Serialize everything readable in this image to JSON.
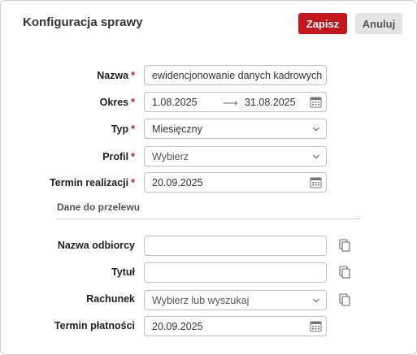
{
  "dialog": {
    "title": "Konfiguracja sprawy",
    "save_label": "Zapisz",
    "cancel_label": "Anuluj"
  },
  "form": {
    "name": {
      "label": "Nazwa",
      "required_mark": "*",
      "value": "ewidencjonowanie danych kadrowych"
    },
    "period": {
      "label": "Okres",
      "required_mark": "*",
      "from": "1.08.2025",
      "arrow": "⟶",
      "to": "31.08.2025"
    },
    "type": {
      "label": "Typ",
      "required_mark": "*",
      "value": "Miesięczny"
    },
    "profile": {
      "label": "Profil",
      "required_mark": "*",
      "placeholder": "Wybierz"
    },
    "deadline": {
      "label": "Termin realizacji",
      "required_mark": "*",
      "value": "20.09.2025"
    }
  },
  "transfer": {
    "section_title": "Dane do przelewu",
    "recipient": {
      "label": "Nazwa odbiorcy",
      "value": ""
    },
    "subject": {
      "label": "Tytuł",
      "value": ""
    },
    "account": {
      "label": "Rachunek",
      "placeholder": "Wybierz lub wyszukaj"
    },
    "payment_date": {
      "label": "Termin płatności",
      "value": "20.09.2025"
    }
  },
  "colors": {
    "accent": "#c4161c",
    "cancel_bg": "#e4e4e4",
    "border": "#bfbfbf"
  },
  "icons": [
    "calendar-icon",
    "chevron-down-icon",
    "copy-icon",
    "arrow-right-icon"
  ]
}
